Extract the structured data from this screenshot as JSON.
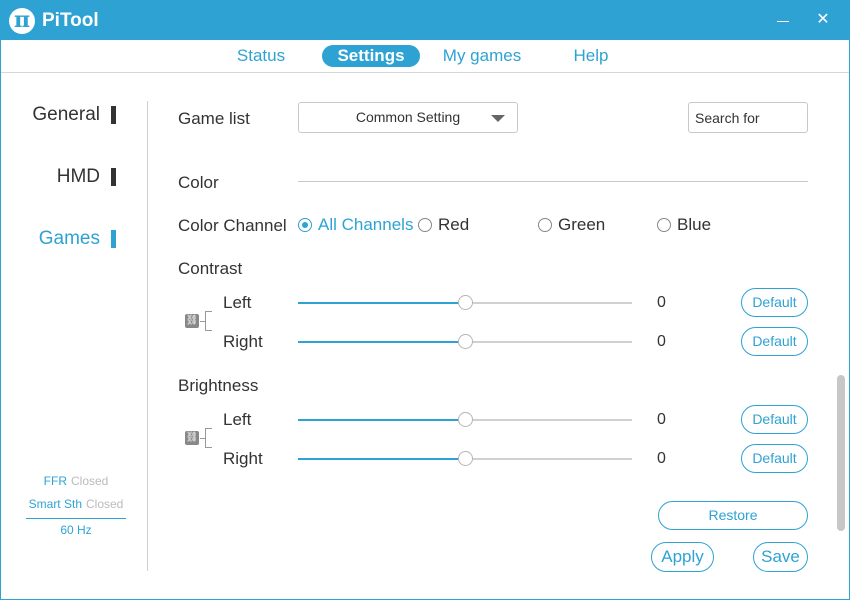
{
  "app": {
    "title": "PiTool",
    "logo_glyph": "π"
  },
  "window_controls": {
    "minimize": "—",
    "close": "✕"
  },
  "nav": {
    "tabs": [
      {
        "label": "Status"
      },
      {
        "label": "Settings",
        "active": true
      },
      {
        "label": "My games"
      },
      {
        "label": "Help"
      }
    ]
  },
  "sidebar": {
    "items": [
      {
        "label": "General"
      },
      {
        "label": "HMD"
      },
      {
        "label": "Games",
        "active": true
      }
    ],
    "status": {
      "ffr_label": "FFR",
      "ffr_value": "Closed",
      "smart_label": "Smart Sth",
      "smart_value": "Closed",
      "refresh": "60 Hz"
    }
  },
  "main": {
    "game_list_label": "Game list",
    "game_list_selected": "Common Setting",
    "search_placeholder": "Search for",
    "color_label": "Color",
    "color_channel_label": "Color Channel",
    "channels": [
      {
        "label": "All Channels",
        "checked": true
      },
      {
        "label": "Red",
        "checked": false
      },
      {
        "label": "Green",
        "checked": false
      },
      {
        "label": "Blue",
        "checked": false
      }
    ],
    "contrast": {
      "title": "Contrast",
      "left_label": "Left",
      "left_value": "0",
      "right_label": "Right",
      "right_value": "0",
      "default_label": "Default"
    },
    "brightness": {
      "title": "Brightness",
      "left_label": "Left",
      "left_value": "0",
      "right_label": "Right",
      "right_value": "0",
      "default_label": "Default"
    },
    "slider_level": 0.5,
    "restore_label": "Restore",
    "apply_label": "Apply",
    "save_label": "Save"
  },
  "colors": {
    "accent": "#2ea3d3",
    "text": "#333333",
    "muted": "#bbbbbb"
  }
}
